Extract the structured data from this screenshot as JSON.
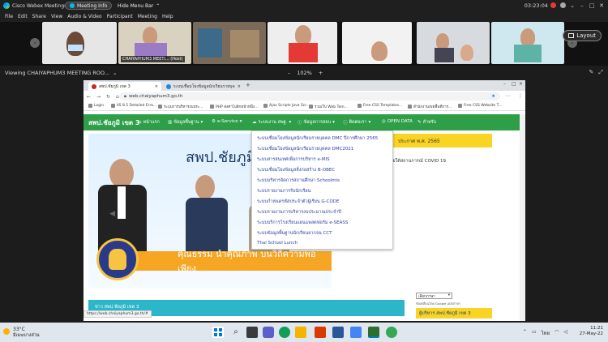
{
  "titlebar": {
    "app_name": "Cisco Webex Meetings",
    "meeting_info": "Meeting Info",
    "hide_menu": "Hide Menu Bar",
    "time": "03:23:04",
    "minimize": "–",
    "maximize": "□",
    "close": "✕",
    "chevron": "⌄"
  },
  "menubar": [
    "File",
    "Edit",
    "Share",
    "View",
    "Audio & Video",
    "Participant",
    "Meeting",
    "Help"
  ],
  "participants": [
    {
      "label": "CHAIYAPHUM3 MEETI... (Host)"
    }
  ],
  "layout_button": "Layout",
  "share": {
    "label": "Viewing CHAIYAPHUM3 MEETING ROO...",
    "zoom": "102%",
    "zoom_out": "–",
    "zoom_in": "+"
  },
  "browser": {
    "tabs": [
      {
        "title": "สพป.ชัยภูมิ เขต 3"
      },
      {
        "title": "ระบบเชื่อมโยงข้อมูลนักเรียนรายบุคคล D..."
      }
    ],
    "url": "web.chaiyaphum3.go.th",
    "bookmarks": [
      "Login",
      "IIS 8.5 Detailed Erro...",
      "ระบบการบริหารงบประ...",
      "PHP ส่งค่าไปอีกหน้าหนึ่ง...",
      "Ajax Scripts Java Scr...",
      "รวมเว็บ Web Tem...",
      "Free CSS Templates...",
      "สำนักงานเขตพื้นที่การ...",
      "Free CSS Website T..."
    ]
  },
  "site": {
    "logo": "สพป.ชัยภูมิ เขต 3",
    "nav": [
      "หน้าแรก",
      "ข้อมูลพื้นฐาน",
      "e-Service",
      "ระบบงาน สพฐ.",
      "ข้อมูลการสอบ",
      "ติดต่อเรา",
      "OPEN DATA",
      "สำหรับ"
    ],
    "banner_title": "สพป.ชัยภูมิ",
    "banner_ribbon": "คุณธรรม นำคุณภาพ บนวิถีความพอเพียง",
    "dropdown": [
      "ระบบเชื่อมโยงข้อมูลนักเรียนรายบุคคล DMC ปีการศึกษา 2565",
      "ระบบเชื่อมโยงข้อมูลนักเรียนรายบุคคล DMC2021",
      "ระบบสารสนเทศเพื่อการบริหาร e-MIS",
      "ระบบเชื่อมโยงข้อมูลสิ่งก่อสร้าง B-OBEC",
      "ระบบบริหารจัดการสถานศึกษา Schoolmis",
      "ระบบรายงานการรับนักเรียน",
      "ระบบกำหนดรหัสประจำตัวผู้เรียน G-CODE",
      "ระบบรายงานการบริหารงบประมาณประจำปี",
      "ระบบบริการโรงเรียนแผนแพลตฟอร์ม e-SEASS",
      "ระบบข้อมูลพื้นฐานนักเรียนยากจน CCT",
      "Thai School Lunch"
    ],
    "news_head": "ประกาศ พ.ศ. 2565",
    "news_item": "นปฏิบัติการบริหารจัดการภายใต้สถานการณ์ COVID 19",
    "news2_label": "ข่าว สพป.ชัยภูมิ เขต 3",
    "status_url": "https://web.chaiyaphum3.go.th/#",
    "side_select": "เลือกภาษา",
    "side_note": "ขับเคลื่อนโดย Google แปลภาษา",
    "side_admin": "ผู้บริหาร สพป.ชัยภูมิ เขต 3"
  },
  "taskbar": {
    "temp": "33°C",
    "weather": "มีเมฆบางส่วน",
    "lang": "ไทย",
    "time": "11:21",
    "date": "27-May-22"
  }
}
